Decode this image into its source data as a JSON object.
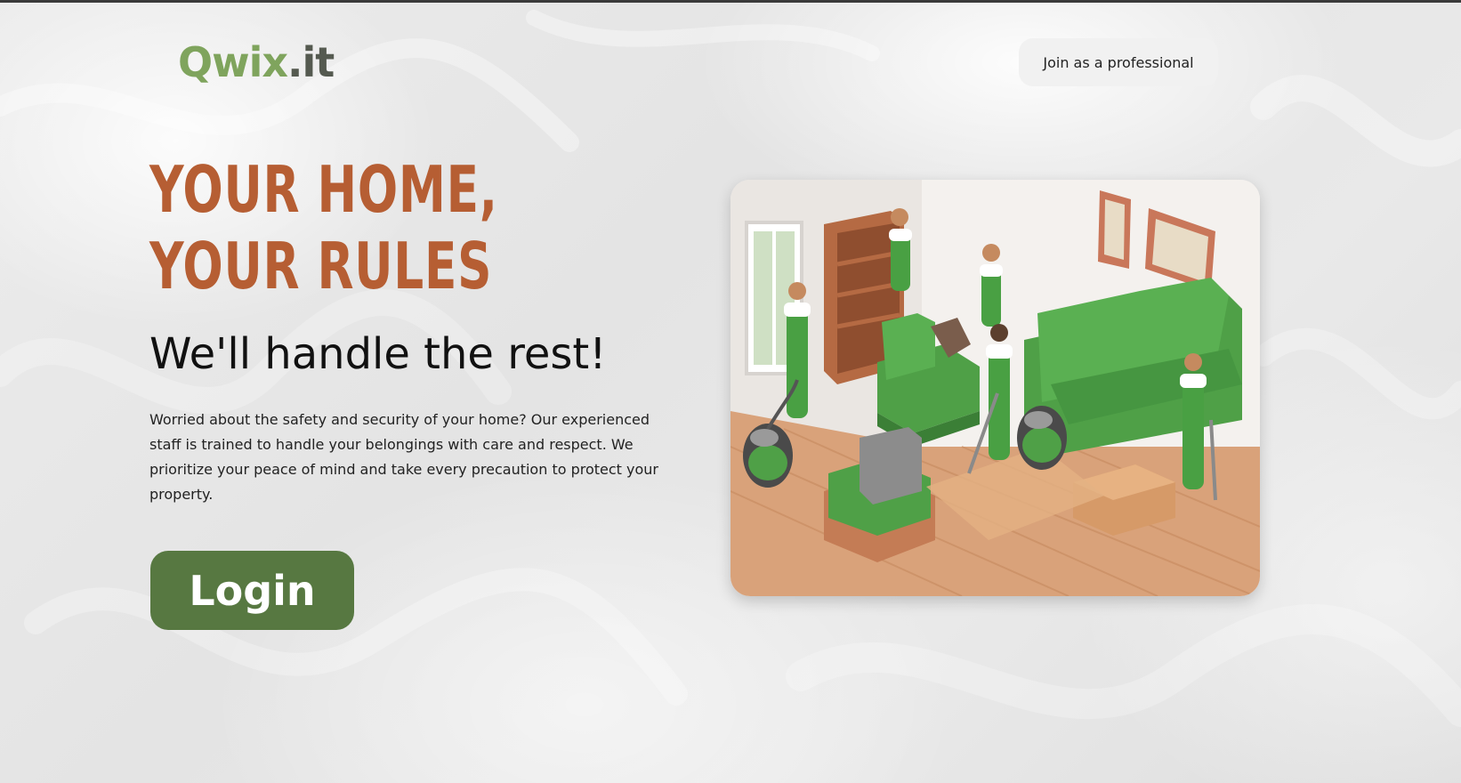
{
  "header": {
    "logo_brand": "Qwix",
    "logo_tld": ".it",
    "join_label": "Join as a professional"
  },
  "hero": {
    "headline": "YOUR HOME, YOUR RULES",
    "subheadline": "We'll handle the rest!",
    "body": "Worried about the safety and security of your home? Our experienced staff is trained to handle your belongings with care and respect. We prioritize your peace of mind and take every precaution to protect your property.",
    "login_label": "Login"
  },
  "colors": {
    "brand_green": "#7fa45d",
    "headline_orange": "#b65e33",
    "button_green": "#577841"
  }
}
